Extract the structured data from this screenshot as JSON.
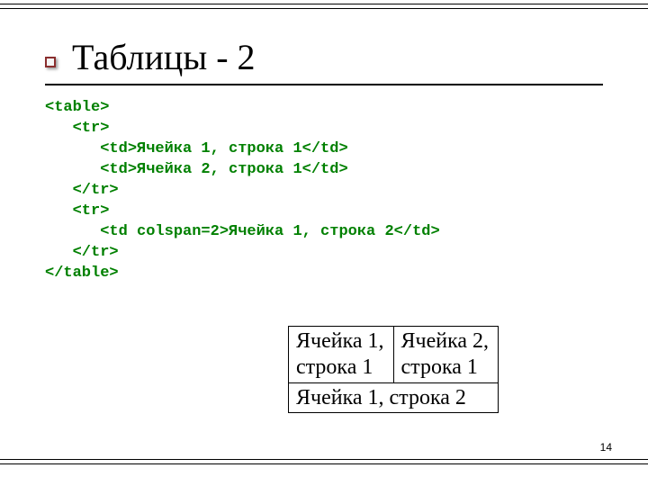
{
  "title": "Таблицы - 2",
  "code": "<table>\n   <tr>\n      <td>Ячейка 1, строка 1</td>\n      <td>Ячейка 2, строка 1</td>\n   </tr>\n   <tr>\n      <td colspan=2>Ячейка 1, строка 2</td>\n   </tr>\n</table>",
  "table": {
    "r1c1a": "Ячейка 1,",
    "r1c1b": "строка 1",
    "r1c2a": "Ячейка 2,",
    "r1c2b": "строка 1",
    "r2": "Ячейка 1, строка 2"
  },
  "page_number": "14"
}
